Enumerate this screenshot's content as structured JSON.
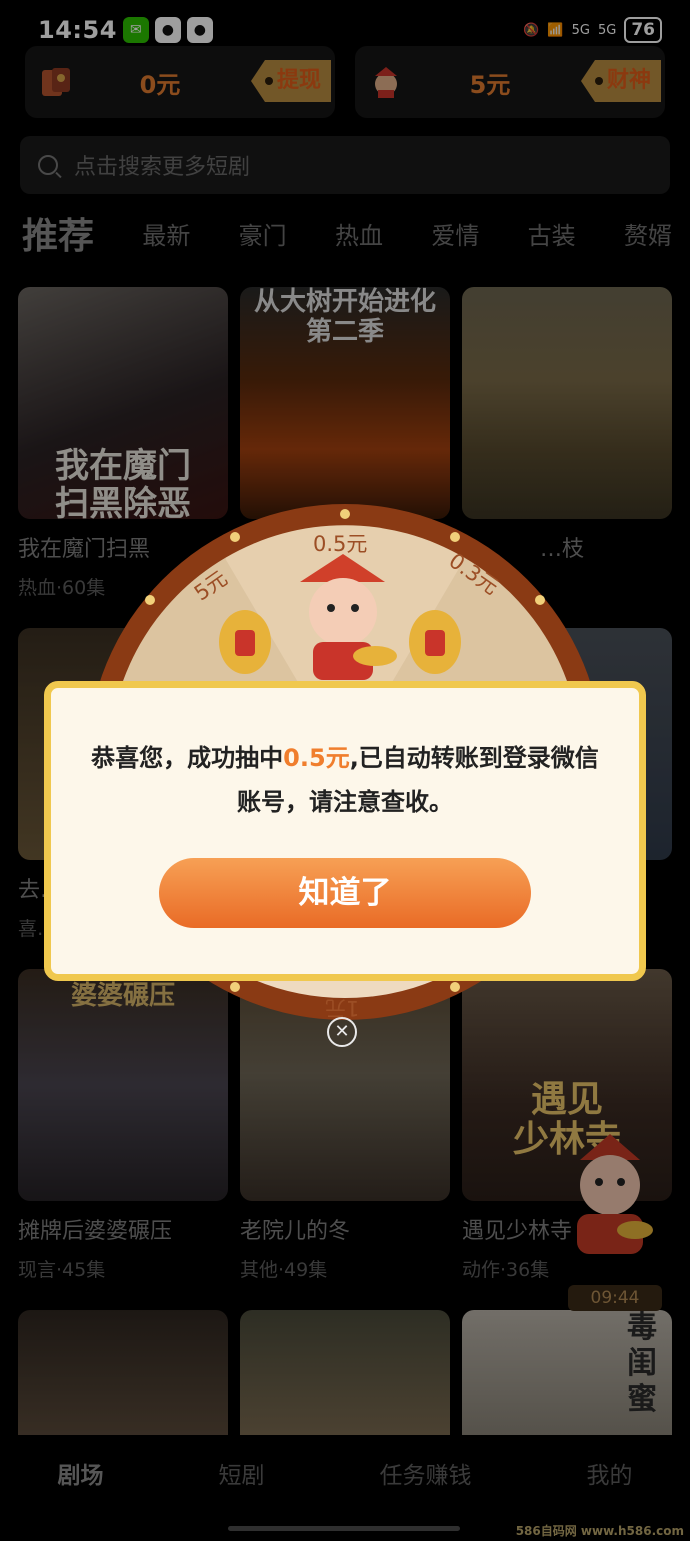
{
  "status_bar": {
    "time": "14:54",
    "signal_labels": [
      "5G",
      "5G"
    ],
    "battery": "76"
  },
  "wallets": [
    {
      "amount": "0元",
      "tag": "提现",
      "icon": "red-envelope-icon"
    },
    {
      "amount": "5元",
      "tag": "财神",
      "icon": "fortune-god-icon"
    }
  ],
  "search": {
    "placeholder": "点击搜索更多短剧"
  },
  "category_tabs": [
    "推荐",
    "最新",
    "豪门",
    "热血",
    "爱情",
    "古装",
    "赘婿"
  ],
  "dramas": [
    {
      "title": "我在魔门扫黑",
      "meta": "热血·60集",
      "poster_text": "我在魔门\n扫黑除恶"
    },
    {
      "title": "",
      "meta": "",
      "poster_text": "从大树开始进化\n第二季"
    },
    {
      "title": "…枝",
      "meta": "",
      "poster_text": ""
    },
    {
      "title": "去…",
      "meta": "喜…",
      "poster_text": ""
    },
    {
      "title": "摊牌后婆婆碾压",
      "meta": "现言·45集",
      "poster_text": "婆婆碾压"
    },
    {
      "title": "老院儿的冬",
      "meta": "其他·49集",
      "poster_text": ""
    },
    {
      "title": "遇见少林寺",
      "meta": "动作·36集",
      "poster_text": "遇见\n少林寺"
    },
    {
      "title": "",
      "meta": "",
      "poster_text": ""
    },
    {
      "title": "",
      "meta": "",
      "poster_text": ""
    },
    {
      "title": "",
      "meta": "",
      "poster_text": "毒\n闺\n蜜"
    }
  ],
  "timer": "09:44",
  "wheel": {
    "labels": [
      "0.5元",
      "0.3元",
      "5元",
      "1元"
    ]
  },
  "dialog": {
    "msg_prefix": "恭喜您，成功抽中",
    "amount": "0.5元",
    "msg_suffix": ",已自动转账到登录微信账号，请注意查收。",
    "button": "知道了"
  },
  "bottom_nav": [
    "剧场",
    "短剧",
    "任务赚钱",
    "我的"
  ],
  "watermark": "586自码网 www.h586.com",
  "colors": {
    "accent": "#f07e2d",
    "dialog_bg": "#fdf7ea",
    "dialog_border": "#f0c84e"
  }
}
